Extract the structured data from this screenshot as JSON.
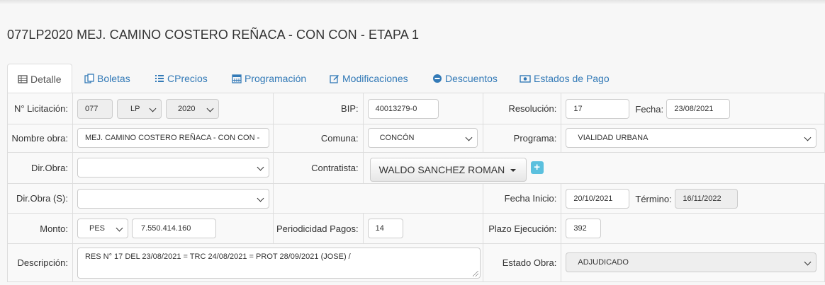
{
  "page_title": "077LP2020 MEJ. CAMINO COSTERO REÑACA - CON CON - ETAPA 1",
  "tabs": [
    {
      "label": "Detalle",
      "icon": "table-icon",
      "active": true
    },
    {
      "label": "Boletas",
      "icon": "copy-icon"
    },
    {
      "label": "CPrecios",
      "icon": "list-icon"
    },
    {
      "label": "Programación",
      "icon": "calendar-icon"
    },
    {
      "label": "Modificaciones",
      "icon": "edit-icon"
    },
    {
      "label": "Descuentos",
      "icon": "minus-circle-icon"
    },
    {
      "label": "Estados de Pago",
      "icon": "money-icon"
    }
  ],
  "form": {
    "licitacion": {
      "label": "N° Licitación:",
      "numero": "077",
      "tipo": "LP",
      "anio": "2020"
    },
    "bip": {
      "label": "BIP:",
      "value": "40013279-0"
    },
    "resolucion": {
      "label": "Resolución:",
      "value": "17",
      "fecha_label": "Fecha:",
      "fecha": "23/08/2021"
    },
    "nombre_obra": {
      "label": "Nombre obra:",
      "value": "MEJ. CAMINO COSTERO REÑACA - CON CON -"
    },
    "comuna": {
      "label": "Comuna:",
      "value": "CONCÓN"
    },
    "programa": {
      "label": "Programa:",
      "value": "VIALIDAD URBANA"
    },
    "dir_obra": {
      "label": "Dir.Obra:",
      "value": ""
    },
    "contratista": {
      "label": "Contratista:",
      "value": "WALDO SANCHEZ ROMAN",
      "add_label": "+"
    },
    "dir_obra_s": {
      "label": "Dir.Obra (S):",
      "value": ""
    },
    "fecha_inicio": {
      "label": "Fecha Inicio:",
      "value": "20/10/2021",
      "termino_label": "Término:",
      "termino": "16/11/2022"
    },
    "monto": {
      "label": "Monto:",
      "moneda": "PES",
      "value": "7.550.414.160"
    },
    "periodicidad": {
      "label": "Periodicidad Pagos:",
      "value": "14"
    },
    "plazo": {
      "label": "Plazo Ejecución:",
      "value": "392"
    },
    "descripcion": {
      "label": "Descripción:",
      "value": "RES N° 17 DEL 23/08/2021 = TRC 24/08/2021 = PROT 28/09/2021 (JOSE) /"
    },
    "estado_obra": {
      "label": "Estado Obra:",
      "value": "ADJUDICADO"
    }
  }
}
